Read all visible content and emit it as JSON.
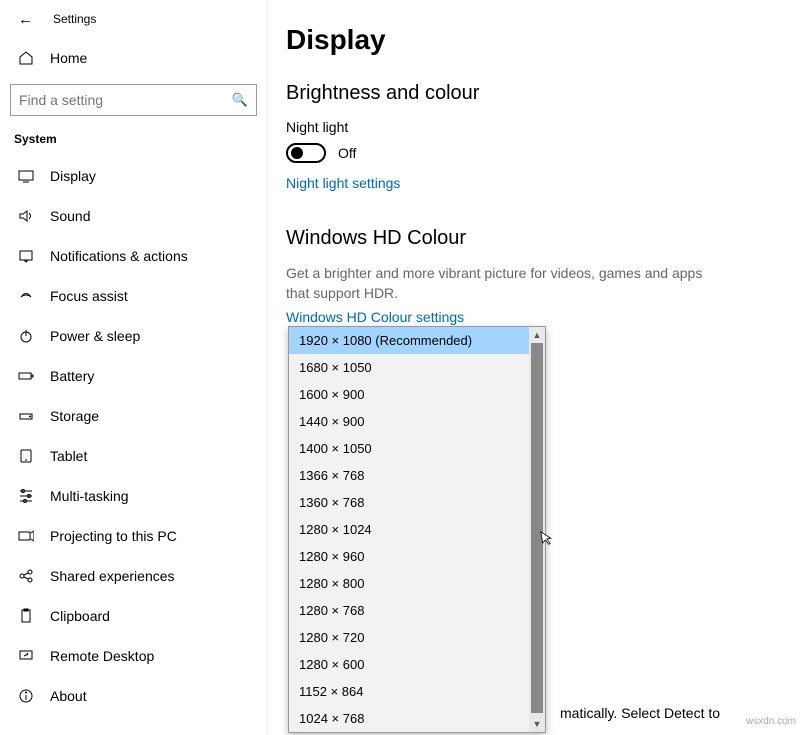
{
  "header": {
    "title": "Settings",
    "home_label": "Home",
    "search_placeholder": "Find a setting",
    "category": "System"
  },
  "sidebar": {
    "items": [
      {
        "label": "Display"
      },
      {
        "label": "Sound"
      },
      {
        "label": "Notifications & actions"
      },
      {
        "label": "Focus assist"
      },
      {
        "label": "Power & sleep"
      },
      {
        "label": "Battery"
      },
      {
        "label": "Storage"
      },
      {
        "label": "Tablet"
      },
      {
        "label": "Multi-tasking"
      },
      {
        "label": "Projecting to this PC"
      },
      {
        "label": "Shared experiences"
      },
      {
        "label": "Clipboard"
      },
      {
        "label": "Remote Desktop"
      },
      {
        "label": "About"
      }
    ]
  },
  "main": {
    "page_title": "Display",
    "brightness_section": "Brightness and colour",
    "night_light_label": "Night light",
    "night_light_state": "Off",
    "night_light_link": "Night light settings",
    "hd_section": "Windows HD Colour",
    "hd_desc": "Get a brighter and more vibrant picture for videos, games and apps that support HDR.",
    "hd_link": "Windows HD Colour settings",
    "bottom_fragment": "matically. Select Detect to"
  },
  "resolution_options": [
    "1920 × 1080 (Recommended)",
    "1680 × 1050",
    "1600 × 900",
    "1440 × 900",
    "1400 × 1050",
    "1366 × 768",
    "1360 × 768",
    "1280 × 1024",
    "1280 × 960",
    "1280 × 800",
    "1280 × 768",
    "1280 × 720",
    "1280 × 600",
    "1152 × 864",
    "1024 × 768"
  ],
  "watermark": "wsxdn.com"
}
